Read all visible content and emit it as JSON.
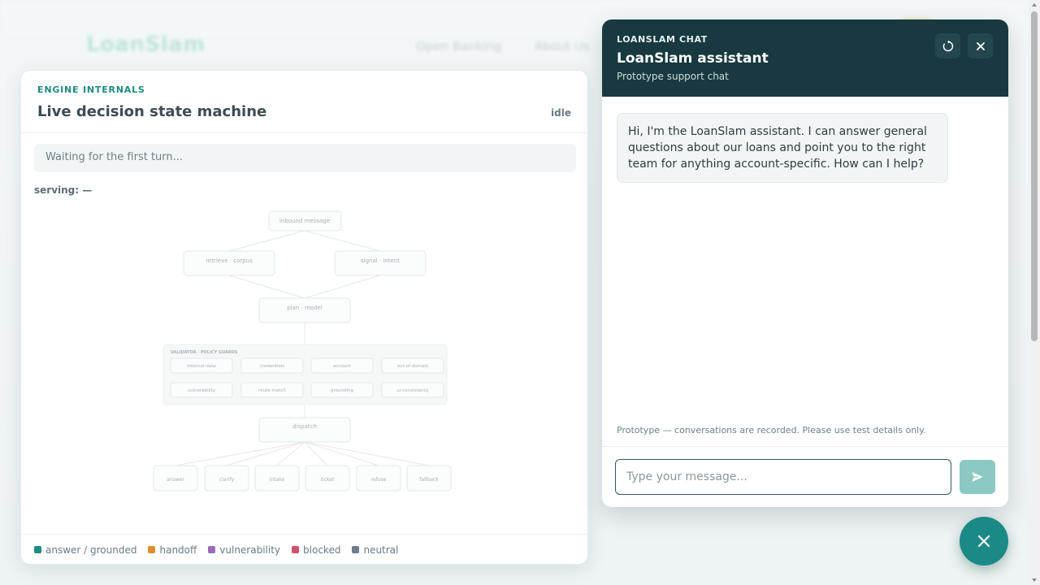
{
  "background": {
    "logo": "LoanSlam",
    "nav": [
      "Open Banking",
      "About Us"
    ]
  },
  "engine": {
    "eyebrow": "ENGINE INTERNALS",
    "title": "Live decision state machine",
    "state": "idle",
    "waiting": "Waiting for the first turn...",
    "serving": "serving: —",
    "nodes": {
      "inbound": "inbound message",
      "retrieve": "retrieve · corpus",
      "signal": "signal · intent",
      "plan": "plan · model",
      "validator_label": "VALIDATOR · POLICY GUARDS",
      "guards": [
        "internal-data",
        "credentials",
        "account",
        "out-of-domain",
        "vulnerability",
        "route-match",
        "grounding",
        "ui-consistency"
      ],
      "dispatch": "dispatch",
      "outcomes": [
        "answer",
        "clarify",
        "intake",
        "ticket",
        "refuse",
        "fallback"
      ]
    },
    "legend": [
      {
        "label": "answer / grounded",
        "color": "#1f8a83"
      },
      {
        "label": "handoff",
        "color": "#e0902a"
      },
      {
        "label": "vulnerability",
        "color": "#9a6bb8"
      },
      {
        "label": "blocked",
        "color": "#d0506a"
      },
      {
        "label": "neutral",
        "color": "#6b7d8a"
      }
    ]
  },
  "chat": {
    "eyebrow": "LOANSLAM CHAT",
    "title": "LoanSlam assistant",
    "subtitle": "Prototype support chat",
    "greeting": "Hi, I'm the LoanSlam assistant. I can answer general questions about our loans and point you to the right team for anything account-specific. How can I help?",
    "notice": "Prototype — conversations are recorded. Please use test details only.",
    "input_placeholder": "Type your message...",
    "input_value": ""
  },
  "colors": {
    "accent": "#1b8a86",
    "header_dark": "#17393f",
    "send_disabled": "#8cc8c4"
  },
  "icons": {
    "refresh": "refresh-icon",
    "close": "close-icon",
    "send": "send-icon",
    "fab": "close-icon"
  }
}
